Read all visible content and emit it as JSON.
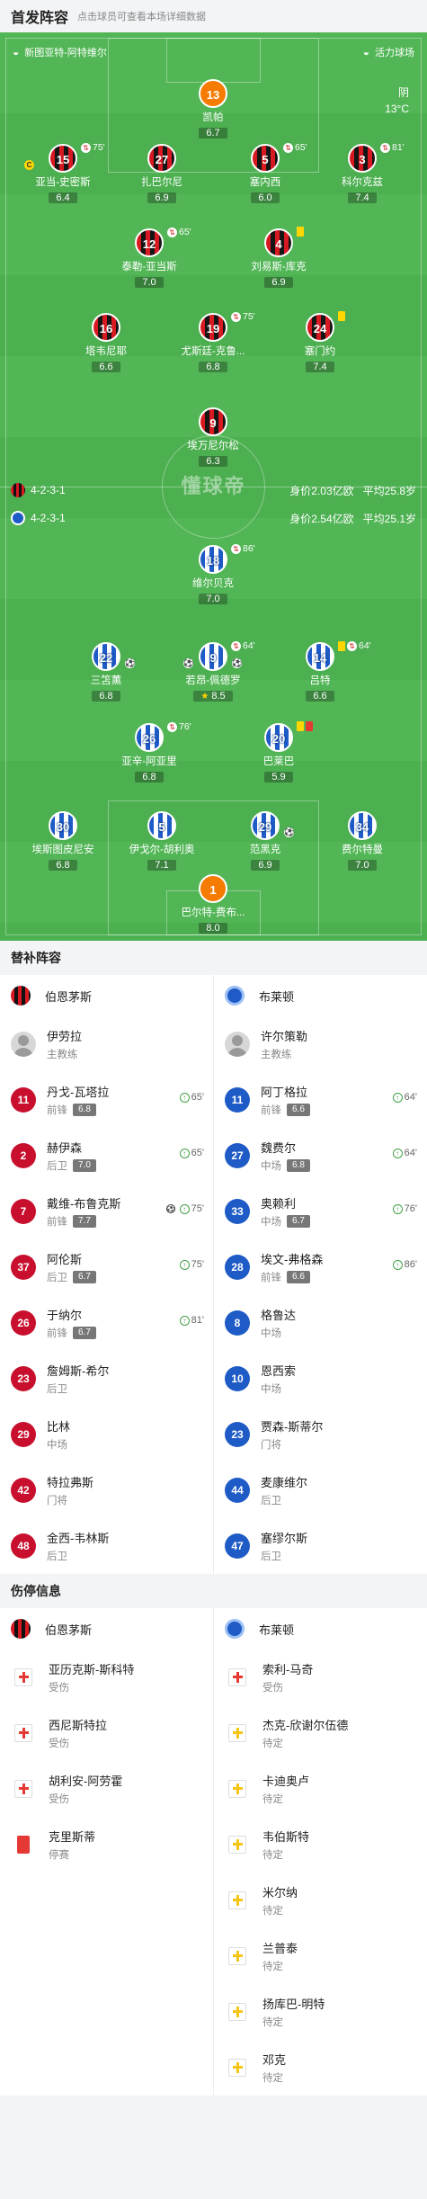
{
  "header": {
    "title": "首发阵容",
    "subtitle": "点击球员可查看本场详细数据"
  },
  "pitch": {
    "home_venue": "新图亚特-阿特维尔",
    "away_venue": "活力球场",
    "weather": "阴",
    "temperature": "13°C",
    "watermark_top": "懂球帝",
    "watermark_bottom": "懂球帝",
    "home_team": {
      "formation": "4-2-3-1",
      "value": "身价2.03亿欧",
      "age": "平均25.8岁"
    },
    "away_team": {
      "formation": "4-2-3-1",
      "value": "身价2.54亿欧",
      "age": "平均25.1岁"
    },
    "home_players": [
      {
        "num": "13",
        "name": "凯帕",
        "rating": "6.7"
      },
      {
        "num": "15",
        "name": "亚当-史密斯",
        "rating": "6.4",
        "sub": "75'"
      },
      {
        "num": "27",
        "name": "扎巴尔尼",
        "rating": "6.9"
      },
      {
        "num": "5",
        "name": "塞内西",
        "rating": "6.0",
        "sub": "65'"
      },
      {
        "num": "3",
        "name": "科尔克兹",
        "rating": "7.4",
        "sub": "81'"
      },
      {
        "num": "12",
        "name": "泰勒-亚当斯",
        "rating": "7.0",
        "sub": "65'"
      },
      {
        "num": "4",
        "name": "刘易斯-库克",
        "rating": "6.9"
      },
      {
        "num": "16",
        "name": "塔韦尼耶",
        "rating": "6.6"
      },
      {
        "num": "19",
        "name": "尤斯廷-克鲁...",
        "rating": "6.8",
        "sub": "75'"
      },
      {
        "num": "24",
        "name": "塞门约",
        "rating": "7.4"
      },
      {
        "num": "9",
        "name": "埃万尼尔松",
        "rating": "6.3"
      }
    ],
    "away_players": [
      {
        "num": "18",
        "name": "维尔贝克",
        "rating": "7.0",
        "sub": "86'"
      },
      {
        "num": "22",
        "name": "三笘薫",
        "rating": "6.8"
      },
      {
        "num": "9",
        "name": "若昂-佩德罗",
        "rating": "8.5",
        "sub": "64'"
      },
      {
        "num": "14",
        "name": "吕特",
        "rating": "6.6",
        "sub": "64'"
      },
      {
        "num": "26",
        "name": "亚辛-阿亚里",
        "rating": "6.8",
        "sub": "76'"
      },
      {
        "num": "20",
        "name": "巴莱巴",
        "rating": "5.9"
      },
      {
        "num": "30",
        "name": "埃斯图皮尼安",
        "rating": "6.8"
      },
      {
        "num": "5",
        "name": "伊戈尔-胡利奥",
        "rating": "7.1"
      },
      {
        "num": "29",
        "name": "范黑克",
        "rating": "6.9"
      },
      {
        "num": "34",
        "name": "费尔特曼",
        "rating": "7.0"
      },
      {
        "num": "1",
        "name": "巴尔特-费布...",
        "rating": "8.0"
      }
    ]
  },
  "subs": {
    "title": "替补阵容",
    "home_team": "伯恩茅斯",
    "away_team": "布莱顿",
    "home_coach": {
      "name": "伊劳拉",
      "role": "主教练"
    },
    "away_coach": {
      "name": "许尔策勒",
      "role": "主教练"
    },
    "home": [
      {
        "num": "11",
        "name": "丹戈-瓦塔拉",
        "pos": "前锋",
        "rating": "6.8",
        "in": "65'"
      },
      {
        "num": "2",
        "name": "赫伊森",
        "pos": "后卫",
        "rating": "7.0",
        "in": "65'"
      },
      {
        "num": "7",
        "name": "戴维-布鲁克斯",
        "pos": "前锋",
        "rating": "7.7",
        "in": "75'",
        "goal": true
      },
      {
        "num": "37",
        "name": "阿伦斯",
        "pos": "后卫",
        "rating": "6.7",
        "in": "75'"
      },
      {
        "num": "26",
        "name": "于纳尔",
        "pos": "前锋",
        "rating": "6.7",
        "in": "81'"
      },
      {
        "num": "23",
        "name": "詹姆斯-希尔",
        "pos": "后卫"
      },
      {
        "num": "29",
        "name": "比林",
        "pos": "中场"
      },
      {
        "num": "42",
        "name": "特拉弗斯",
        "pos": "门将"
      },
      {
        "num": "48",
        "name": "金西-韦林斯",
        "pos": "后卫"
      }
    ],
    "away": [
      {
        "num": "11",
        "name": "阿丁格拉",
        "pos": "前锋",
        "rating": "6.6",
        "in": "64'"
      },
      {
        "num": "27",
        "name": "魏费尔",
        "pos": "中场",
        "rating": "6.8",
        "in": "64'"
      },
      {
        "num": "33",
        "name": "奥赖利",
        "pos": "中场",
        "rating": "6.7",
        "in": "76'"
      },
      {
        "num": "28",
        "name": "埃文-弗格森",
        "pos": "前锋",
        "rating": "6.6",
        "in": "86'"
      },
      {
        "num": "8",
        "name": "格鲁达",
        "pos": "中场"
      },
      {
        "num": "10",
        "name": "恩西索",
        "pos": "中场"
      },
      {
        "num": "23",
        "name": "贾森-斯蒂尔",
        "pos": "门将"
      },
      {
        "num": "44",
        "name": "麦康维尔",
        "pos": "后卫"
      },
      {
        "num": "47",
        "name": "塞缪尔斯",
        "pos": "后卫"
      }
    ]
  },
  "injuries": {
    "title": "伤停信息",
    "home_team": "伯恩茅斯",
    "away_team": "布莱顿",
    "home": [
      {
        "name": "亚历克斯-斯科特",
        "status": "受伤",
        "icon": "red"
      },
      {
        "name": "西尼斯特拉",
        "status": "受伤",
        "icon": "red"
      },
      {
        "name": "胡利安-阿劳霍",
        "status": "受伤",
        "icon": "red"
      },
      {
        "name": "克里斯蒂",
        "status": "停赛",
        "icon": "card"
      }
    ],
    "away": [
      {
        "name": "索利-马奇",
        "status": "受伤",
        "icon": "red"
      },
      {
        "name": "杰克-欣谢尔伍德",
        "status": "待定",
        "icon": "yel"
      },
      {
        "name": "卡迪奥卢",
        "status": "待定",
        "icon": "yel"
      },
      {
        "name": "韦伯斯特",
        "status": "待定",
        "icon": "yel"
      },
      {
        "name": "米尔纳",
        "status": "待定",
        "icon": "yel"
      },
      {
        "name": "兰普泰",
        "status": "待定",
        "icon": "yel"
      },
      {
        "name": "扬库巴-明特",
        "status": "待定",
        "icon": "yel"
      },
      {
        "name": "邓克",
        "status": "待定",
        "icon": "yel"
      }
    ]
  },
  "colors": {
    "pitch": "#4caf50",
    "bournemouth": "#c8102e",
    "brighton": "#1e5bc6",
    "goalkeeper": "#f57c00"
  }
}
